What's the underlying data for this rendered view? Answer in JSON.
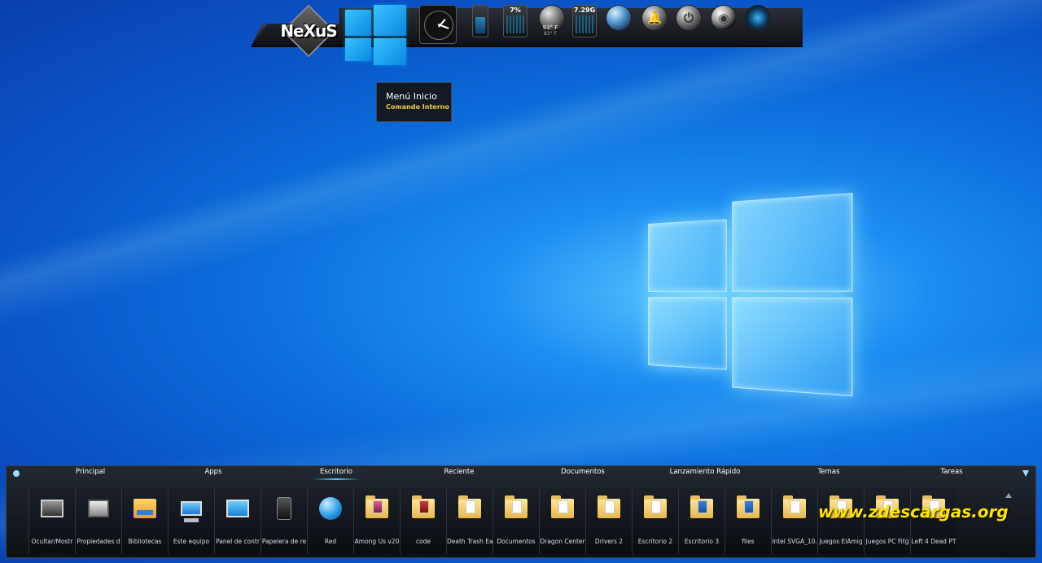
{
  "top_bar": {
    "logo_text": "NeXuS",
    "gadgets": {
      "cpu_percent": "7%",
      "weather_temp": "93° F",
      "weather_sub": "83° F",
      "ram": "7.29G"
    }
  },
  "tooltip": {
    "title": "Menú Inicio",
    "subtitle": "Comando Interno"
  },
  "dock": {
    "tabs": [
      {
        "label": "Principal"
      },
      {
        "label": "Apps"
      },
      {
        "label": "Escritorio"
      },
      {
        "label": "Reciente"
      },
      {
        "label": "Documentos"
      },
      {
        "label": "Lanzamiento Rápido"
      },
      {
        "label": "Temas"
      },
      {
        "label": "Tareas"
      }
    ],
    "items": [
      {
        "label": "Ocultar/Mostr",
        "icon": "monitor-icon"
      },
      {
        "label": "Propiedades d",
        "icon": "display-properties-icon"
      },
      {
        "label": "Bibliotecas",
        "icon": "libraries-icon"
      },
      {
        "label": "Este equipo",
        "icon": "computer-icon"
      },
      {
        "label": "Panel de contr",
        "icon": "control-panel-icon"
      },
      {
        "label": "Papelera de re",
        "icon": "recycle-bin-icon"
      },
      {
        "label": "Red",
        "icon": "network-globe-icon"
      },
      {
        "label": "Among Us v20",
        "icon": "folder-icon"
      },
      {
        "label": "code",
        "icon": "folder-icon"
      },
      {
        "label": "Death Trash Ea",
        "icon": "folder-icon"
      },
      {
        "label": "Documentos",
        "icon": "folder-icon"
      },
      {
        "label": "Dragon Center",
        "icon": "folder-icon"
      },
      {
        "label": "Drivers 2",
        "icon": "folder-icon"
      },
      {
        "label": "Escritorio 2",
        "icon": "folder-icon"
      },
      {
        "label": "Escritorio 3",
        "icon": "folder-icon"
      },
      {
        "label": "files",
        "icon": "folder-icon"
      },
      {
        "label": "Intel SVGA_10.",
        "icon": "folder-icon"
      },
      {
        "label": "Juegos ElAmig",
        "icon": "folder-icon"
      },
      {
        "label": "Juegos PC Fitg",
        "icon": "folder-icon"
      },
      {
        "label": "Left 4 Dead PT",
        "icon": "folder-icon"
      }
    ]
  },
  "watermark": "www.zdescargas.org"
}
